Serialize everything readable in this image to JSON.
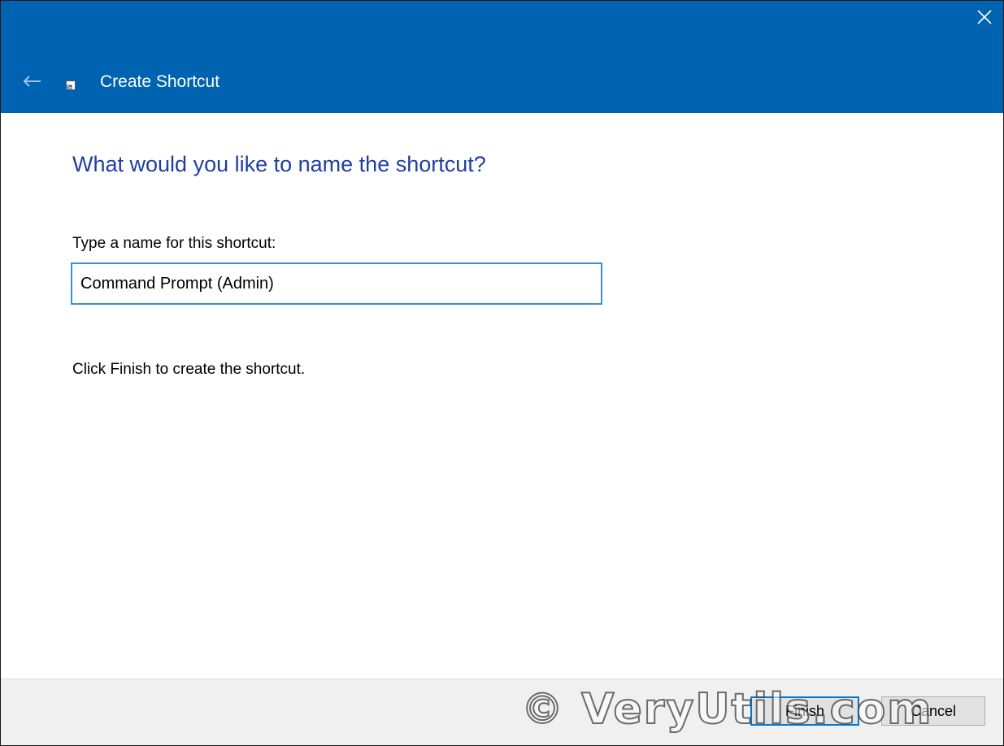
{
  "window": {
    "title": "Create Shortcut",
    "accent_color": "#0063b1"
  },
  "icons": {
    "close": "close-icon",
    "back": "back-arrow-icon",
    "app": "shortcut-icon"
  },
  "main": {
    "heading": "What would you like to name the shortcut?",
    "name_label": "Type a name for this shortcut:",
    "name_value": "Command Prompt (Admin)",
    "hint": "Click Finish to create the shortcut."
  },
  "footer": {
    "finish_label": "Finish",
    "cancel_label": "Cancel"
  },
  "watermark": {
    "text": "© VeryUtils.com"
  }
}
